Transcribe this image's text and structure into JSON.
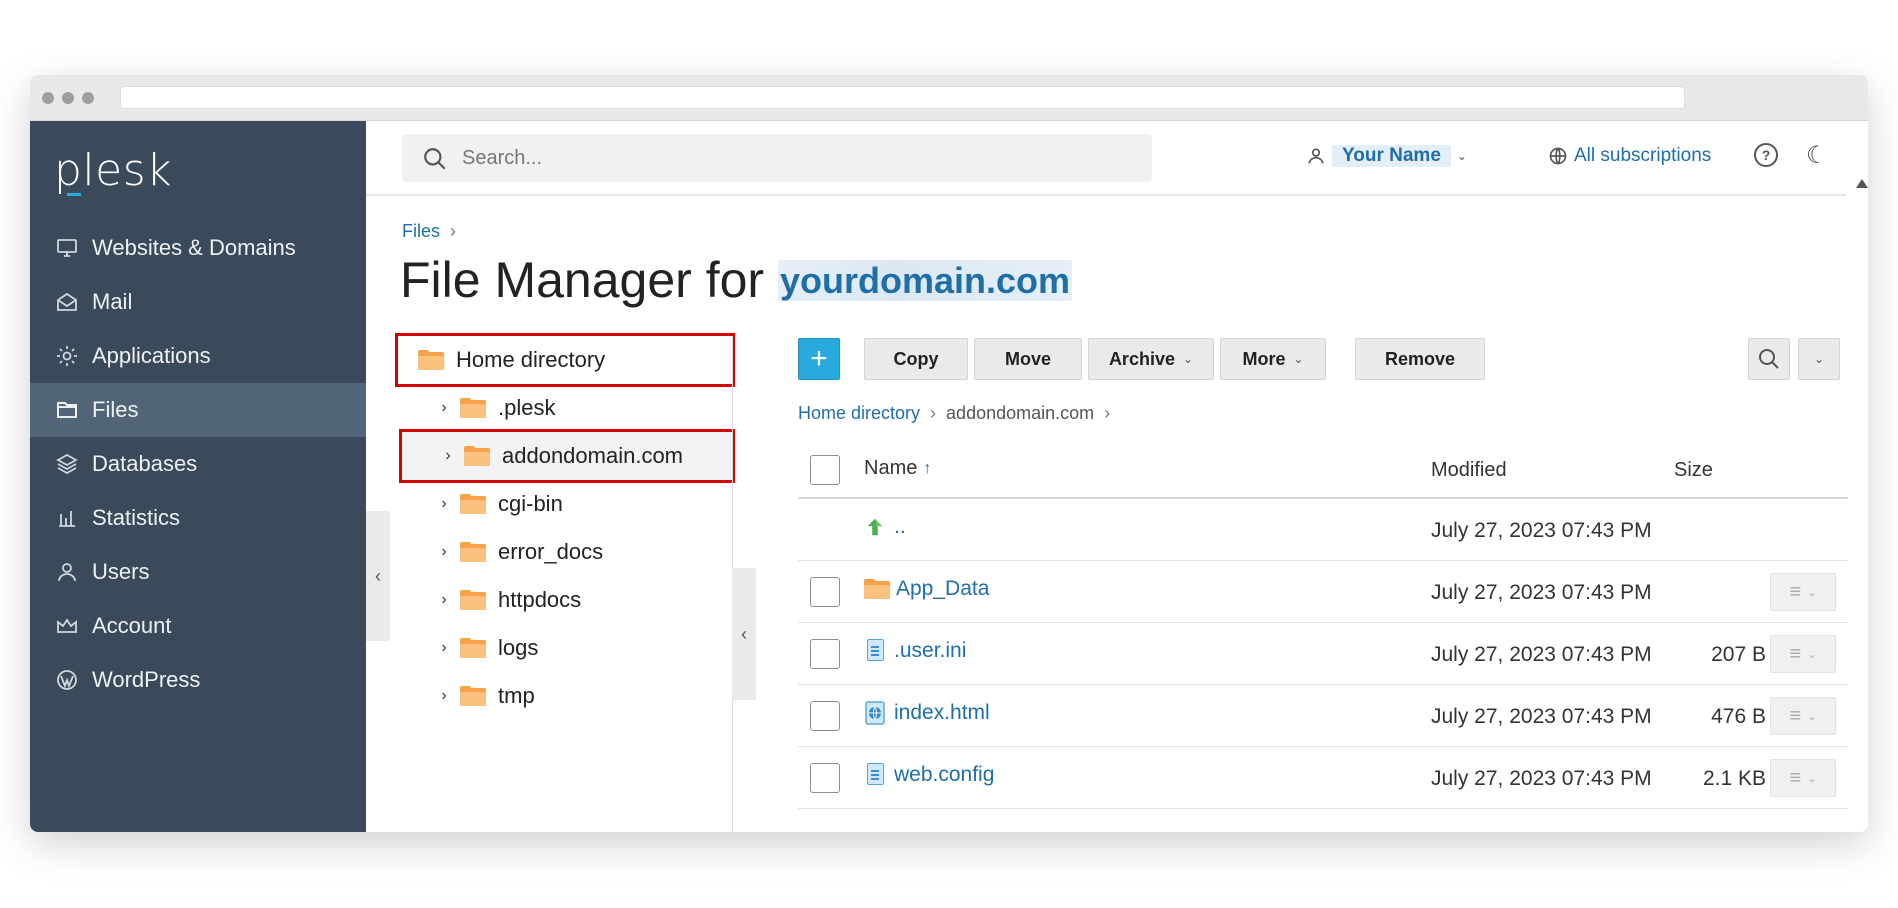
{
  "brand": {
    "logo_text": "plesk"
  },
  "sidebar": {
    "items": [
      {
        "label": "Websites & Domains",
        "icon": "monitor-icon"
      },
      {
        "label": "Mail",
        "icon": "mail-icon"
      },
      {
        "label": "Applications",
        "icon": "gear-icon"
      },
      {
        "label": "Files",
        "icon": "folder-icon",
        "active": true
      },
      {
        "label": "Databases",
        "icon": "layers-icon"
      },
      {
        "label": "Statistics",
        "icon": "bar-chart-icon"
      },
      {
        "label": "Users",
        "icon": "user-icon"
      },
      {
        "label": "Account",
        "icon": "crown-icon"
      },
      {
        "label": "WordPress",
        "icon": "wordpress-icon"
      }
    ]
  },
  "header": {
    "search_placeholder": "Search...",
    "user_name": "Your Name",
    "subscriptions": "All subscriptions",
    "help": "?"
  },
  "breadcrumb": {
    "root": "Files"
  },
  "title": {
    "prefix": "File Manager for",
    "domain": "yourdomain.com"
  },
  "tree": {
    "root": "Home directory",
    "items": [
      ".plesk",
      "addondomain.com",
      "cgi-bin",
      "error_docs",
      "httpdocs",
      "logs",
      "tmp"
    ]
  },
  "toolbar": {
    "add": "+",
    "copy": "Copy",
    "move": "Move",
    "archive": "Archive",
    "more": "More",
    "remove": "Remove"
  },
  "path": {
    "root": "Home directory",
    "current": "addondomain.com"
  },
  "table": {
    "headers": {
      "name": "Name",
      "modified": "Modified",
      "size": "Size",
      "sort_arrow": "↑"
    },
    "rows": [
      {
        "name": "..",
        "modified": "July 27, 2023 07:43 PM",
        "size": "",
        "type": "parent-dir-icon"
      },
      {
        "name": "App_Data",
        "modified": "July 27, 2023 07:43 PM",
        "size": "",
        "type": "folder-icon"
      },
      {
        "name": ".user.ini",
        "modified": "July 27, 2023 07:43 PM",
        "size": "207 B",
        "type": "file-icon"
      },
      {
        "name": "index.html",
        "modified": "July 27, 2023 07:43 PM",
        "size": "476 B",
        "type": "html-file-icon"
      },
      {
        "name": "web.config",
        "modified": "July 27, 2023 07:43 PM",
        "size": "2.1 KB",
        "type": "file-icon"
      }
    ]
  },
  "colors": {
    "sidebar_bg": "#3b4a5a",
    "sidebar_active": "#526578",
    "accent": "#28aade",
    "link": "#1f6ea8",
    "highlight": "#d50000",
    "folder": "#f6a24b"
  }
}
